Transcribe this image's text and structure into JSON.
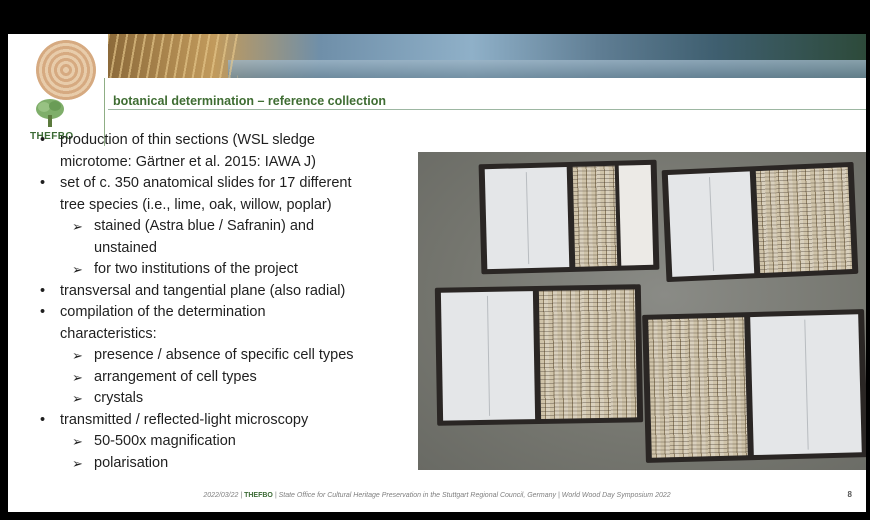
{
  "header": {
    "logo_text": "THEFBO",
    "title": "botanical determination – reference collection"
  },
  "bullets": [
    {
      "level": 1,
      "lines": [
        "production of thin sections (WSL sledge",
        "microtome: Gärtner et al. 2015: IAWA J)"
      ]
    },
    {
      "level": 1,
      "lines": [
        "set of c. 350 anatomical slides for 17 different",
        "tree species (i.e., lime, oak, willow, poplar)"
      ]
    },
    {
      "level": 2,
      "lines": [
        "stained (Astra blue / Safranin) and",
        "unstained"
      ]
    },
    {
      "level": 2,
      "lines": [
        "for two institutions of the project"
      ]
    },
    {
      "level": 1,
      "lines": [
        "transversal and tangential plane (also radial)"
      ]
    },
    {
      "level": 1,
      "lines": [
        "compilation of the determination",
        "characteristics:"
      ]
    },
    {
      "level": 2,
      "lines": [
        "presence / absence of specific cell types"
      ]
    },
    {
      "level": 2,
      "lines": [
        "arrangement of cell types"
      ]
    },
    {
      "level": 2,
      "lines": [
        "crystals"
      ]
    },
    {
      "level": 1,
      "lines": [
        "transmitted / reflected-light microscopy"
      ]
    },
    {
      "level": 2,
      "lines": [
        "50-500x magnification"
      ]
    },
    {
      "level": 2,
      "lines": [
        "polarisation"
      ]
    }
  ],
  "footer": {
    "date": "2022/03/22",
    "sep1": " | ",
    "org": "THEFBO",
    "sep2": " | ",
    "text": "State Office for Cultural Heritage Preservation in the Stuttgart Regional Council, Germany | World Wood Day Symposium 2022",
    "page": "8"
  },
  "colors": {
    "accent_green": "#3f6d33",
    "background": "#ffffff",
    "frame": "#000000"
  }
}
